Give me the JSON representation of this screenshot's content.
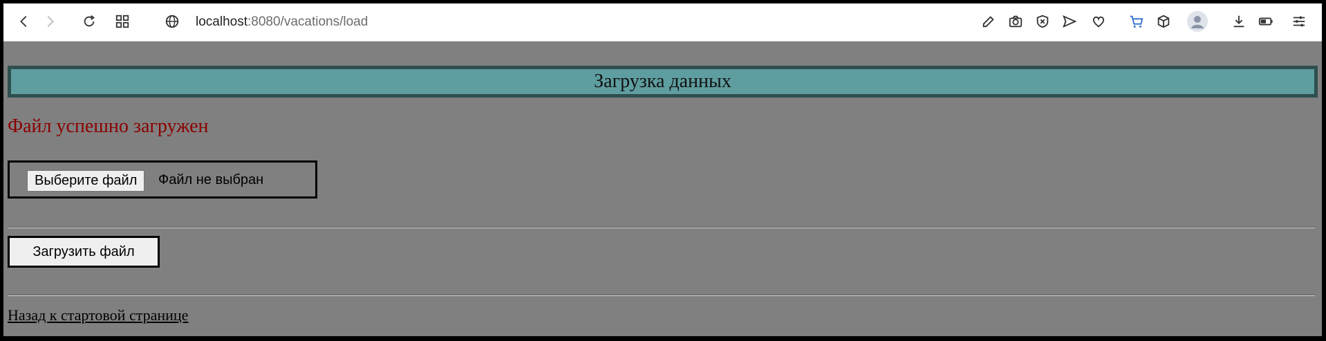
{
  "browser": {
    "url_host": "localhost",
    "url_path": ":8080/vacations/load",
    "icons": [
      "back-icon",
      "forward-icon",
      "reload-icon",
      "apps-icon",
      "globe-icon",
      "edit-icon",
      "camera-icon",
      "shield-x-icon",
      "send-icon",
      "heart-icon",
      "cart-icon",
      "box-icon",
      "profile-icon",
      "download-icon",
      "battery-icon",
      "settings-icon"
    ]
  },
  "page": {
    "header_title": "Загрузка данных",
    "status_message": "Файл успешно загружен",
    "file_input": {
      "button_label": "Выберите файл",
      "no_file_text": "Файл не выбран"
    },
    "upload_button_label": "Загрузить файл",
    "back_link_text": "Назад к стартовой странице"
  },
  "colors": {
    "page_bg": "#808080",
    "header_bg": "#5f9ea0",
    "header_border": "#2f4f4f",
    "status_text": "#8b0000"
  }
}
